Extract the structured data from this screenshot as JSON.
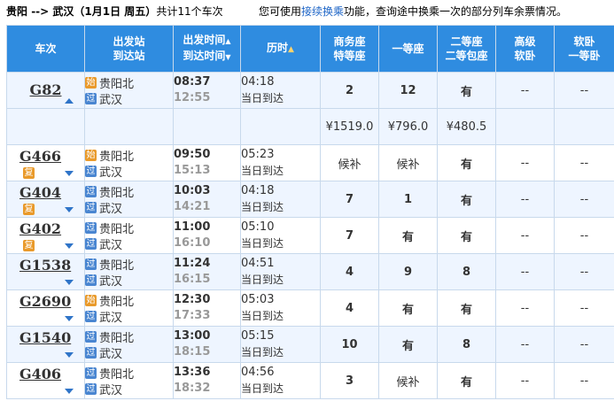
{
  "header": {
    "route_from": "贵阳",
    "route_arrow": "-->",
    "route_to": "武汉",
    "route_date": "（1月1日  周五）",
    "route_count": "共计11个车次",
    "tip_prefix": "您可使用",
    "tip_link": "接续换乘",
    "tip_suffix": "功能，查询途中换乘一次的部分列车余票情况。"
  },
  "columns": {
    "train_no": "车次",
    "station_from": "出发站",
    "station_to": "到达站",
    "time_dep": "出发时间",
    "time_arr": "到达时间",
    "duration": "历时",
    "business_1": "商务座",
    "business_2": "特等座",
    "first": "一等座",
    "second_1": "二等座",
    "second_2": "二等包座",
    "soft_1": "高级",
    "soft_2": "软卧",
    "sleep_1": "软卧",
    "sleep_2": "一等卧"
  },
  "badges": {
    "start": "始",
    "pass": "过",
    "fu": "复"
  },
  "icons": {
    "sort_up": "▲",
    "sort_down": "▼",
    "expand": "chevron-down-icon",
    "collapse": "chevron-up-icon"
  },
  "colors": {
    "header_bg": "#2f8ce0",
    "available": "#1a9a1a",
    "waitlist": "#e8a31a",
    "price": "#f08c2b"
  },
  "trains": [
    {
      "no": "G82",
      "from": "贵阳北",
      "to": "武汉",
      "from_badge": "始",
      "to_badge": "过",
      "dep": "08:37",
      "arr": "12:55",
      "dur": "04:18",
      "arrive": "当日到达",
      "business": "2",
      "first": "12",
      "second": "有",
      "soft": "--",
      "sleep": "--"
    },
    {
      "no": "G466",
      "from": "贵阳北",
      "to": "武汉",
      "from_badge": "始",
      "to_badge": "过",
      "dep": "09:50",
      "arr": "15:13",
      "dur": "05:23",
      "arrive": "当日到达",
      "business": "候补",
      "first": "候补",
      "second": "有",
      "soft": "--",
      "sleep": "--"
    },
    {
      "no": "G404",
      "from": "贵阳北",
      "to": "武汉",
      "from_badge": "过",
      "to_badge": "过",
      "dep": "10:03",
      "arr": "14:21",
      "dur": "04:18",
      "arrive": "当日到达",
      "business": "7",
      "first": "1",
      "second": "有",
      "soft": "--",
      "sleep": "--"
    },
    {
      "no": "G402",
      "from": "贵阳北",
      "to": "武汉",
      "from_badge": "过",
      "to_badge": "过",
      "dep": "11:00",
      "arr": "16:10",
      "dur": "05:10",
      "arrive": "当日到达",
      "business": "7",
      "first": "有",
      "second": "有",
      "soft": "--",
      "sleep": "--"
    },
    {
      "no": "G1538",
      "from": "贵阳北",
      "to": "武汉",
      "from_badge": "过",
      "to_badge": "过",
      "dep": "11:24",
      "arr": "16:15",
      "dur": "04:51",
      "arrive": "当日到达",
      "business": "4",
      "first": "9",
      "second": "8",
      "soft": "--",
      "sleep": "--"
    },
    {
      "no": "G2690",
      "from": "贵阳北",
      "to": "武汉",
      "from_badge": "始",
      "to_badge": "过",
      "dep": "12:30",
      "arr": "17:33",
      "dur": "05:03",
      "arrive": "当日到达",
      "business": "4",
      "first": "有",
      "second": "有",
      "soft": "--",
      "sleep": "--"
    },
    {
      "no": "G1540",
      "from": "贵阳北",
      "to": "武汉",
      "from_badge": "过",
      "to_badge": "过",
      "dep": "13:00",
      "arr": "18:15",
      "dur": "05:15",
      "arrive": "当日到达",
      "business": "10",
      "first": "有",
      "second": "8",
      "soft": "--",
      "sleep": "--"
    },
    {
      "no": "G406",
      "from": "贵阳北",
      "to": "武汉",
      "from_badge": "过",
      "to_badge": "过",
      "dep": "13:36",
      "arr": "18:32",
      "dur": "04:56",
      "arrive": "当日到达",
      "business": "3",
      "first": "候补",
      "second": "有",
      "soft": "--",
      "sleep": "--"
    }
  ],
  "prices": {
    "business": "¥1519.0",
    "first": "¥796.0",
    "second": "¥480.5"
  }
}
